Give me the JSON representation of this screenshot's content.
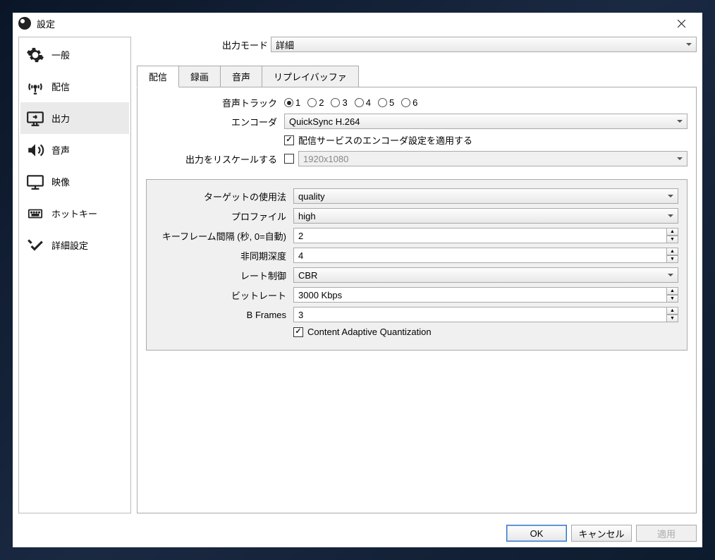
{
  "window": {
    "title": "設定"
  },
  "sidebar": {
    "items": [
      {
        "label": "一般"
      },
      {
        "label": "配信"
      },
      {
        "label": "出力"
      },
      {
        "label": "音声"
      },
      {
        "label": "映像"
      },
      {
        "label": "ホットキー"
      },
      {
        "label": "詳細設定"
      }
    ]
  },
  "main": {
    "output_mode_label": "出力モード",
    "output_mode_value": "詳細",
    "tabs": [
      {
        "label": "配信"
      },
      {
        "label": "録画"
      },
      {
        "label": "音声"
      },
      {
        "label": "リプレイバッファ"
      }
    ],
    "audio_track_label": "音声トラック",
    "audio_tracks": [
      "1",
      "2",
      "3",
      "4",
      "5",
      "6"
    ],
    "audio_track_selected": "1",
    "encoder_label": "エンコーダ",
    "encoder_value": "QuickSync H.264",
    "apply_service_settings_label": "配信サービスのエンコーダ設定を適用する",
    "apply_service_settings_checked": true,
    "rescale_label": "出力をリスケールする",
    "rescale_checked": false,
    "rescale_value": "1920x1080",
    "encoder_settings": {
      "target_usage_label": "ターゲットの使用法",
      "target_usage_value": "quality",
      "profile_label": "プロファイル",
      "profile_value": "high",
      "keyframe_label": "キーフレーム間隔 (秒, 0=自動)",
      "keyframe_value": "2",
      "async_depth_label": "非同期深度",
      "async_depth_value": "4",
      "rate_control_label": "レート制御",
      "rate_control_value": "CBR",
      "bitrate_label": "ビットレート",
      "bitrate_value": "3000 Kbps",
      "bframes_label": "B Frames",
      "bframes_value": "3",
      "caq_label": "Content Adaptive Quantization",
      "caq_checked": true
    }
  },
  "buttons": {
    "ok": "OK",
    "cancel": "キャンセル",
    "apply": "適用"
  }
}
